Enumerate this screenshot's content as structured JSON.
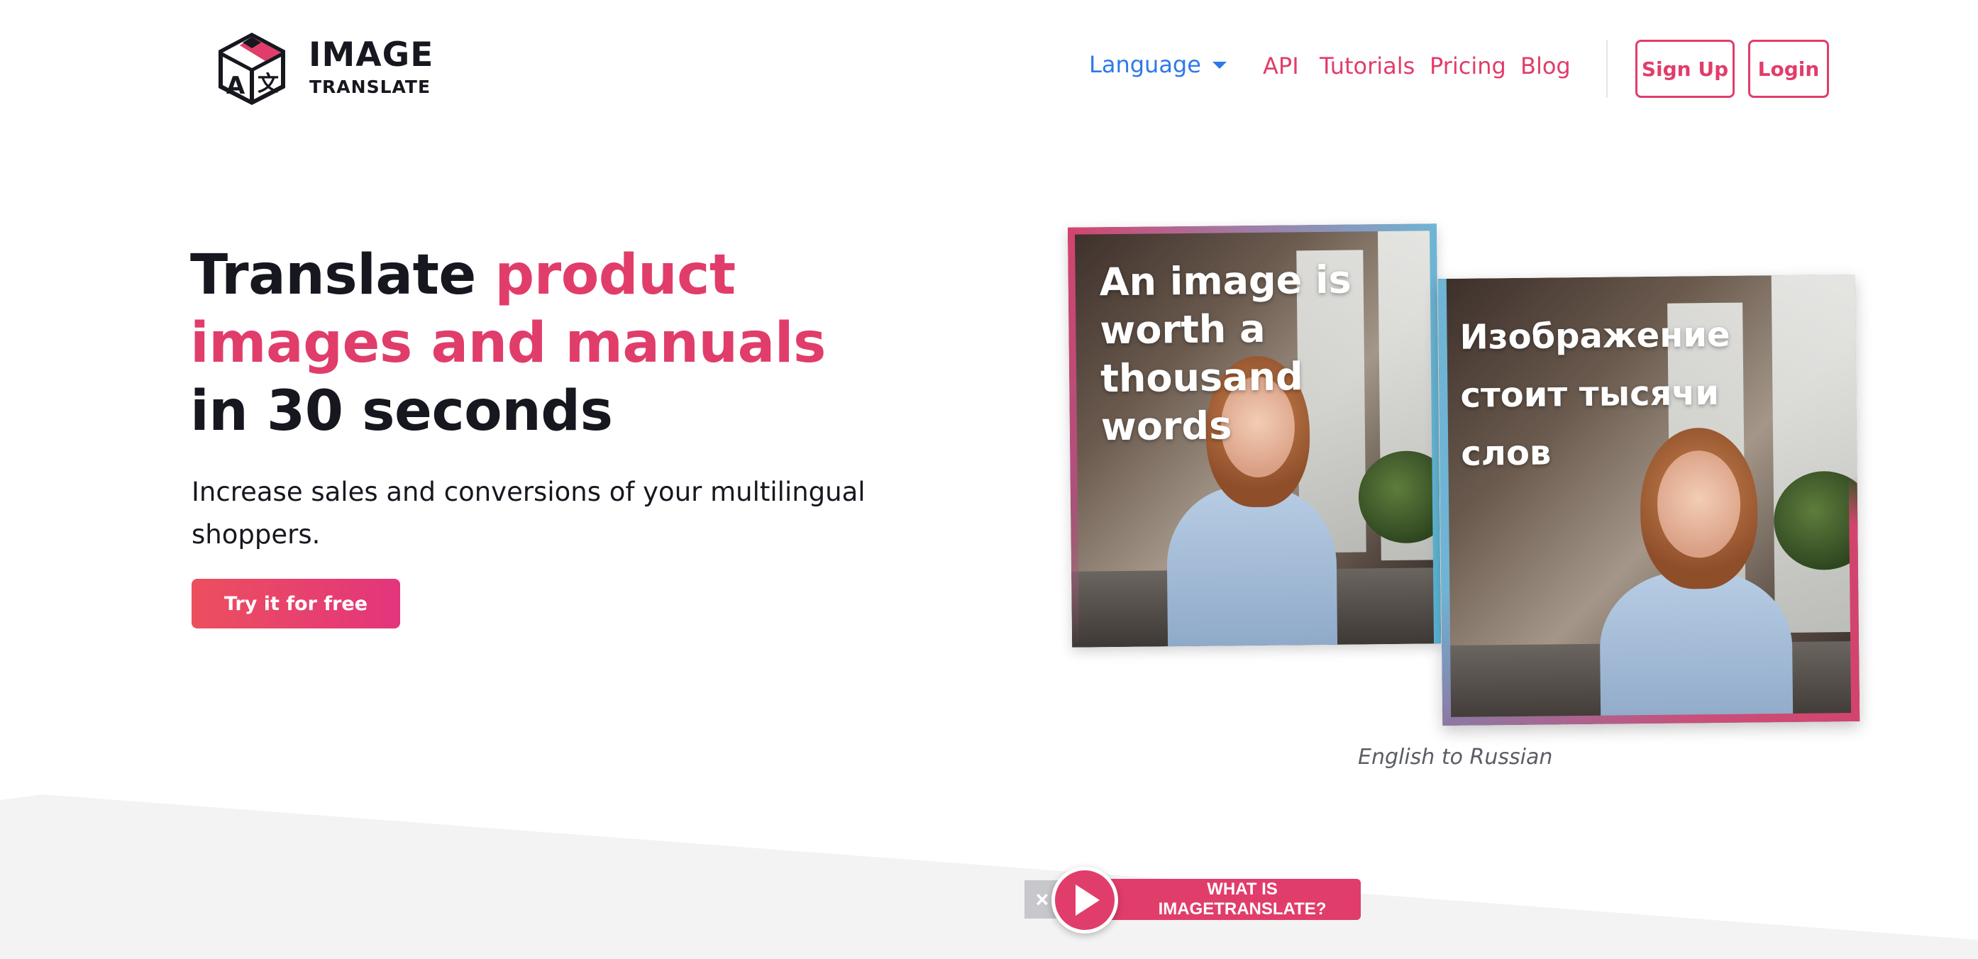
{
  "colors": {
    "brand_pink": "#e13d6a",
    "language_blue": "#2f78e8",
    "text_dark": "#16171f",
    "band_gray": "#f3f3f4"
  },
  "header": {
    "logo": {
      "word1": "IMAGE",
      "word2": "TRANSLATE",
      "cube_letter_left": "A",
      "cube_letter_right": "文",
      "icon": "translate-cube-icon"
    },
    "language_label": "Language",
    "nav": {
      "api": "API",
      "tutorials": "Tutorials",
      "pricing": "Pricing",
      "blog": "Blog"
    },
    "sign_up": "Sign Up",
    "login": "Login"
  },
  "hero": {
    "title_part1": "Translate ",
    "title_highlight": "product images and manuals",
    "title_part2": " in 30 seconds",
    "subtitle": "Increase sales and conversions of your multilingual shoppers.",
    "cta": "Try it for free"
  },
  "showcase": {
    "original_text": [
      "An image is",
      "worth a",
      "thousand",
      "words"
    ],
    "translated_text": [
      "Изображение",
      "стоит тысячи",
      "слов"
    ],
    "caption": "English to Russian"
  },
  "video_widget": {
    "label": "WHAT IS IMAGETRANSLATE?",
    "close": "×",
    "play_icon": "play-icon"
  }
}
